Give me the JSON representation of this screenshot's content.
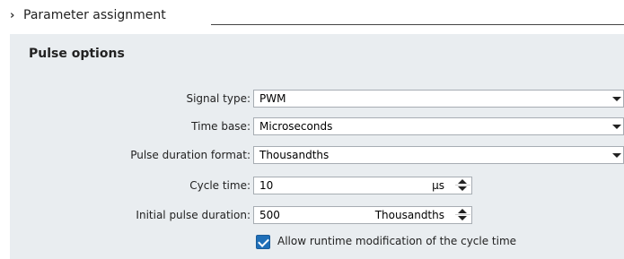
{
  "section": {
    "title": "Parameter assignment"
  },
  "panel": {
    "title": "Pulse options"
  },
  "fields": {
    "signal_type": {
      "label": "Signal type:",
      "value": "PWM"
    },
    "time_base": {
      "label": "Time base:",
      "value": "Microseconds"
    },
    "pulse_duration_format": {
      "label": "Pulse duration format:",
      "value": "Thousandths"
    },
    "cycle_time": {
      "label": "Cycle time:",
      "value": "10",
      "unit": "µs"
    },
    "initial_pulse_duration": {
      "label": "Initial pulse duration:",
      "value": "500",
      "unit": "Thousandths"
    }
  },
  "options": {
    "allow_runtime_modification": {
      "label": "Allow runtime modification of the cycle time",
      "checked": true
    }
  },
  "colors": {
    "panel_bg": "#e9edf0",
    "checkbox_accent": "#1f6fb8"
  }
}
